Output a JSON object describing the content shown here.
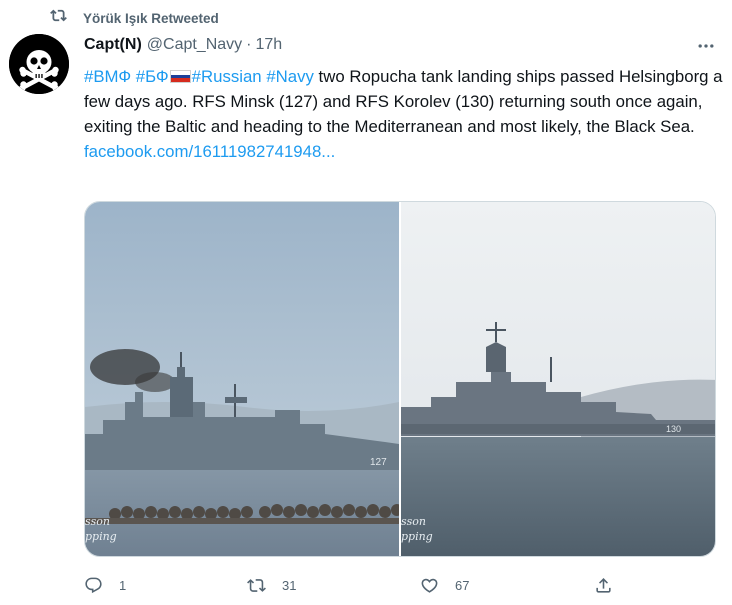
{
  "retweet": {
    "label": "Yörük Işık Retweeted",
    "icon": "retweet-icon"
  },
  "author": {
    "name": "Capt(N)",
    "handle": "@Capt_Navy",
    "separator": "·",
    "time": "17h",
    "avatar_icon": "pirate-skull-avatar"
  },
  "tweet": {
    "tags": [
      "#ВМФ",
      "#БФ",
      "#Russian",
      "#Navy"
    ],
    "flag": "russian-flag-emoji",
    "text_after_tags": " two Ropucha tank landing ships passed Helsingborg a few days ago. RFS Minsk (127) and RFS Korolev (130) returning south once again, exiting the Baltic and heading to the Mediterranean and most likely, the Black Sea.",
    "link": "facebook.com/16111982741948..."
  },
  "media": {
    "left_photo": {
      "hull_number": "127",
      "watermark_line1": "sson",
      "watermark_line2": "pping"
    },
    "right_photo": {
      "hull_number": "130",
      "watermark_line1": "sson",
      "watermark_line2": "pping"
    }
  },
  "actions": {
    "reply": {
      "icon": "reply-icon",
      "count": "1"
    },
    "retweet": {
      "icon": "retweet-icon",
      "count": "31"
    },
    "like": {
      "icon": "heart-icon",
      "count": "67"
    },
    "share": {
      "icon": "share-icon"
    }
  },
  "colors": {
    "link": "#1d9bf0",
    "secondary_text": "#536471",
    "primary_text": "#0f1419",
    "border": "#cfd9de"
  }
}
